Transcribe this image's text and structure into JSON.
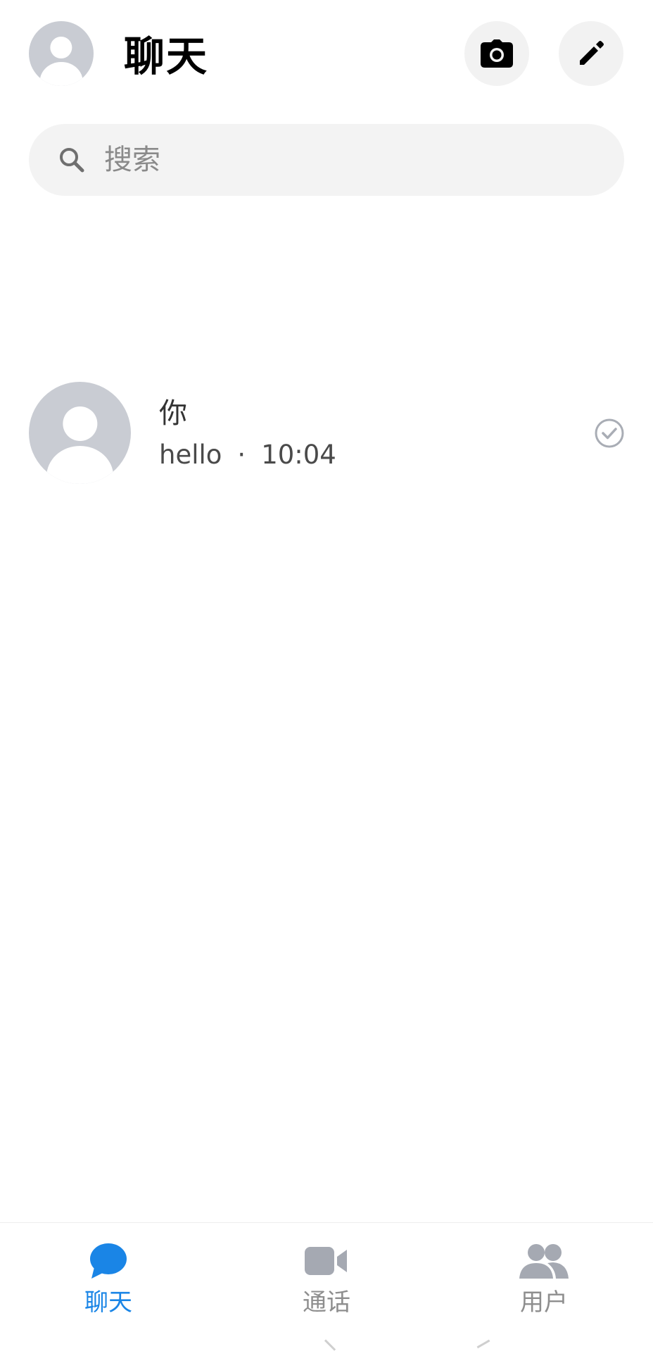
{
  "header": {
    "title": "聊天",
    "avatar_icon": "user-avatar-icon",
    "camera_icon": "camera-icon",
    "edit_icon": "pencil-icon"
  },
  "search": {
    "placeholder": "搜索",
    "icon": "search-icon"
  },
  "chats": [
    {
      "name": "你",
      "message": "hello",
      "separator": "·",
      "time": "10:04",
      "status_icon": "read-check-icon"
    }
  ],
  "bottom_nav": {
    "items": [
      {
        "label": "聊天",
        "icon": "chat-bubble-icon",
        "active": true
      },
      {
        "label": "通话",
        "icon": "video-camera-icon",
        "active": false
      },
      {
        "label": "用户",
        "icon": "users-icon",
        "active": false
      }
    ]
  },
  "colors": {
    "accent": "#1a85e6",
    "inactive": "#8e8e8e",
    "avatar_bg": "#c9ccd3",
    "search_bg": "#f3f3f3"
  }
}
